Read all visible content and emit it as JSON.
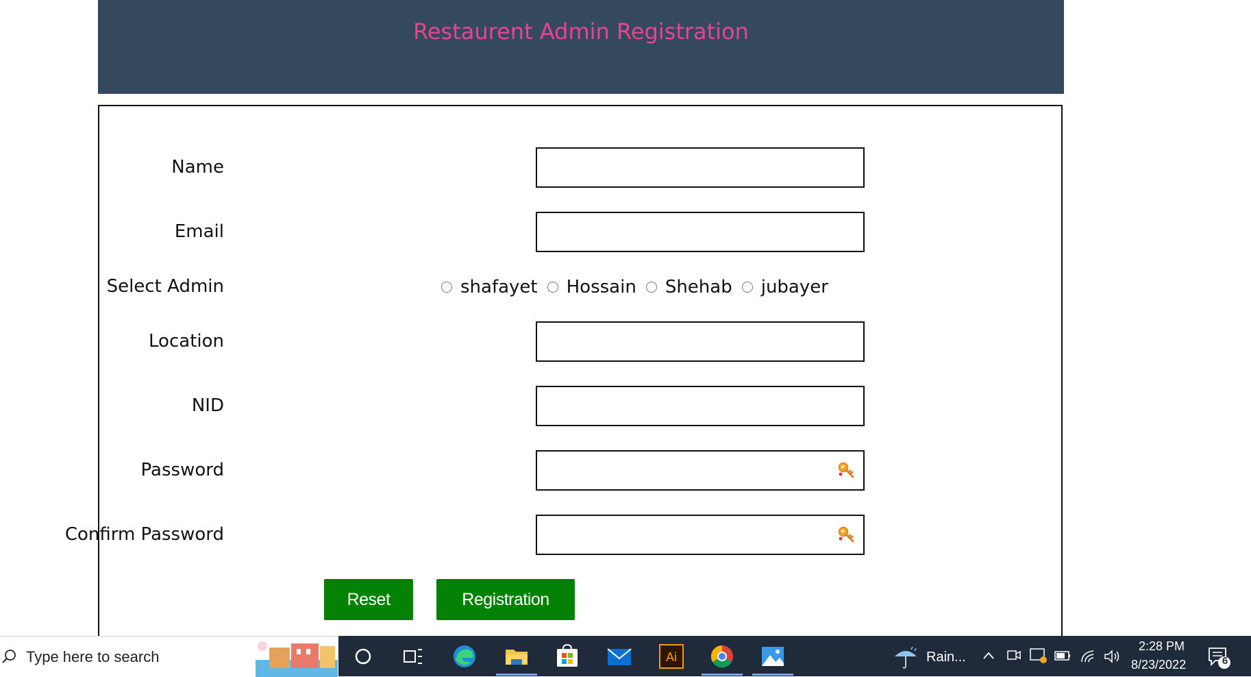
{
  "page": {
    "title": "Restaurent Admin Registration",
    "colors": {
      "header_bg": "#34495e",
      "title": "#e64591",
      "button": "#058205"
    }
  },
  "form": {
    "name_label": "Name",
    "email_label": "Email",
    "select_admin_label": "Select Admin",
    "admins": [
      "shafayet",
      "Hossain",
      "Shehab",
      "jubayer"
    ],
    "location_label": "Location",
    "nid_label": "NID",
    "password_label": "Password",
    "confirm_password_label": "Confirm Password",
    "reset_label": "Reset",
    "registration_label": "Registration",
    "values": {
      "name": "",
      "email": "",
      "location": "",
      "nid": "",
      "password": "",
      "confirm_password": ""
    }
  },
  "taskbar": {
    "search_placeholder": "Type here to search",
    "weather": "Rain...",
    "time": "2:28 PM",
    "date": "8/23/2022",
    "notification_count": "6",
    "icons": [
      "search-icon",
      "cortana-icon",
      "task-view-icon",
      "edge-icon",
      "file-explorer-icon",
      "store-icon",
      "mail-icon",
      "illustrator-icon",
      "chrome-icon",
      "photos-icon"
    ],
    "illustrator_text": "Ai"
  }
}
